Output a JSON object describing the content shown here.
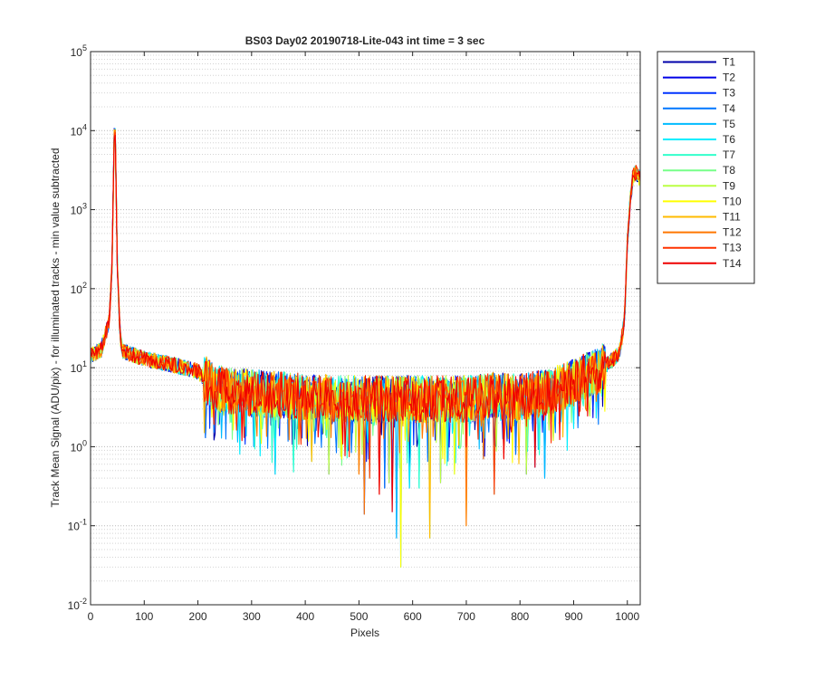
{
  "chart_data": {
    "type": "line",
    "title": "BS03 Day02 20190718-Lite-043 int time = 3 sec",
    "xlabel": "Pixels",
    "ylabel": "Track Mean Signal (ADU/pix) - for illuminated tracks - min value subtracted",
    "xlim": [
      0,
      1024
    ],
    "ylim": [
      0.01,
      100000
    ],
    "yscale": "log",
    "grid": "on (major and minor, y)",
    "legend_position": "outside-top-right",
    "x_ticks": [
      {
        "value": 0,
        "label": "0"
      },
      {
        "value": 100,
        "label": "100"
      },
      {
        "value": 200,
        "label": "200"
      },
      {
        "value": 300,
        "label": "300"
      },
      {
        "value": 400,
        "label": "400"
      },
      {
        "value": 500,
        "label": "500"
      },
      {
        "value": 600,
        "label": "600"
      },
      {
        "value": 700,
        "label": "700"
      },
      {
        "value": 800,
        "label": "800"
      },
      {
        "value": 900,
        "label": "900"
      },
      {
        "value": 1000,
        "label": "1000"
      }
    ],
    "y_ticks": [
      {
        "value": 0.01,
        "base": "10",
        "exp": "-2"
      },
      {
        "value": 0.1,
        "base": "10",
        "exp": "-1"
      },
      {
        "value": 1,
        "base": "10",
        "exp": "0"
      },
      {
        "value": 10,
        "base": "10",
        "exp": "1"
      },
      {
        "value": 100,
        "base": "10",
        "exp": "2"
      },
      {
        "value": 1000,
        "base": "10",
        "exp": "3"
      },
      {
        "value": 10000,
        "base": "10",
        "exp": "4"
      },
      {
        "value": 100000,
        "base": "10",
        "exp": "5"
      }
    ],
    "profile": {
      "x": [
        0,
        20,
        35,
        40,
        43,
        45,
        47,
        50,
        55,
        60,
        100,
        150,
        200,
        230,
        300,
        400,
        500,
        600,
        700,
        750,
        800,
        850,
        900,
        950,
        985,
        995,
        1000,
        1005,
        1010,
        1015,
        1020,
        1024
      ],
      "y": [
        14,
        17,
        40,
        200,
        3000,
        25000,
        3000,
        200,
        25,
        16,
        13,
        11,
        9,
        5.5,
        4.8,
        4.2,
        4,
        4,
        4,
        4.5,
        4.2,
        4.8,
        6.5,
        9.5,
        15,
        40,
        400,
        1200,
        2500,
        3000,
        2600,
        2500
      ]
    },
    "dips": {
      "x": [
        215,
        248,
        263,
        305,
        318,
        345,
        378,
        412,
        445,
        468,
        500,
        510,
        520,
        538,
        548,
        556,
        562,
        571,
        578,
        595,
        612,
        633,
        652,
        678,
        700,
        733,
        752,
        770,
        792,
        812,
        828,
        846,
        862
      ],
      "y": [
        1.3,
        2.5,
        2.6,
        1.0,
        1.1,
        0.45,
        0.48,
        0.65,
        0.45,
        0.7,
        0.45,
        0.14,
        0.4,
        0.25,
        0.3,
        0.35,
        0.15,
        0.07,
        0.03,
        0.3,
        0.3,
        0.07,
        0.35,
        0.45,
        0.1,
        0.7,
        0.25,
        0.7,
        0.8,
        0.45,
        0.55,
        0.4,
        1.2
      ]
    },
    "series": [
      {
        "name": "T1",
        "color": "#0000AA"
      },
      {
        "name": "T2",
        "color": "#0000E6"
      },
      {
        "name": "T3",
        "color": "#0033FF"
      },
      {
        "name": "T4",
        "color": "#0077FF"
      },
      {
        "name": "T5",
        "color": "#00BBFF"
      },
      {
        "name": "T6",
        "color": "#00EEFF"
      },
      {
        "name": "T7",
        "color": "#33FFCC"
      },
      {
        "name": "T8",
        "color": "#77FF88"
      },
      {
        "name": "T9",
        "color": "#BBFF44"
      },
      {
        "name": "T10",
        "color": "#FFFF00"
      },
      {
        "name": "T11",
        "color": "#FFBB00"
      },
      {
        "name": "T12",
        "color": "#FF7700"
      },
      {
        "name": "T13",
        "color": "#FF3300"
      },
      {
        "name": "T14",
        "color": "#EE0000"
      }
    ]
  }
}
